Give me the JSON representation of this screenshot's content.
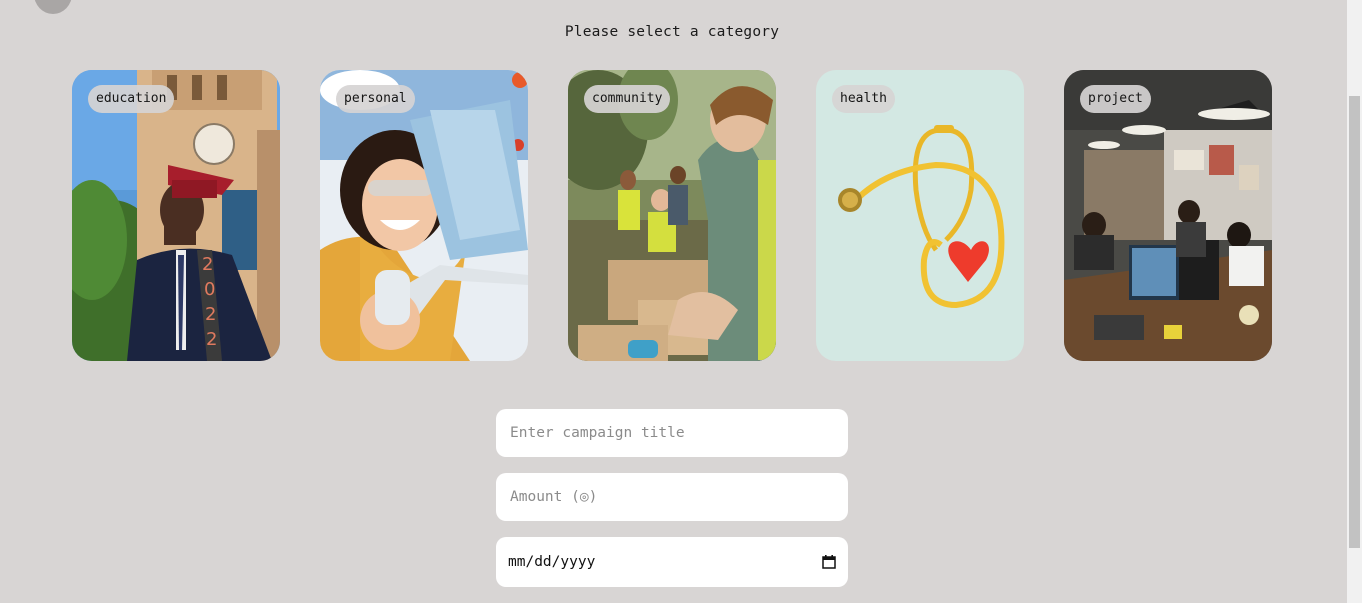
{
  "heading": "Please select a category",
  "categories": [
    {
      "label": "education",
      "icon": "graduate-photo"
    },
    {
      "label": "personal",
      "icon": "smiling-painter-photo"
    },
    {
      "label": "community",
      "icon": "volunteers-photo"
    },
    {
      "label": "health",
      "icon": "stethoscope-heart-photo"
    },
    {
      "label": "project",
      "icon": "office-workspace-photo"
    }
  ],
  "form": {
    "title_placeholder": "Enter campaign title",
    "amount_placeholder": "Amount (◎)",
    "date_value": "mm/dd/yyyy"
  },
  "colors": {
    "background": "#d8d5d4",
    "field_bg": "#ffffff",
    "tag_bg": "#d6d4d4"
  }
}
